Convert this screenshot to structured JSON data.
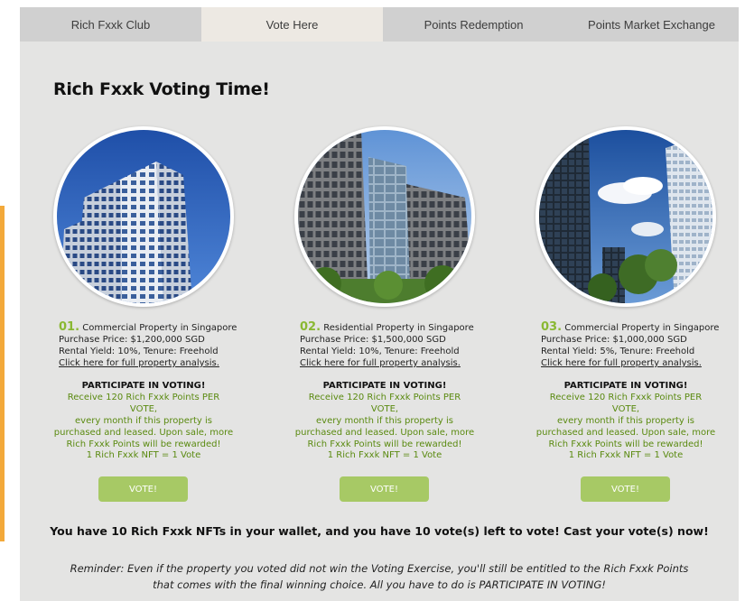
{
  "nav": {
    "tabs": [
      {
        "label": "Rich Fxxk Club",
        "active": false
      },
      {
        "label": "Vote Here",
        "active": true
      },
      {
        "label": "Points Redemption",
        "active": false
      },
      {
        "label": "Points Market Exchange",
        "active": false
      }
    ]
  },
  "page": {
    "title": "Rich Fxxk Voting Time!"
  },
  "properties": [
    {
      "number": "01.",
      "type": "Commercial Property in Singapore",
      "price": "Purchase Price: $1,200,000 SGD",
      "yield": "Rental Yield: 10%, Tenure: Freehold",
      "link": "Click here for full property analysis.",
      "participate_heading": "PARTICIPATE IN VOTING!",
      "participate_lines": [
        "Receive 120 Rich Fxxk Points PER VOTE,",
        "every month if this property is",
        "purchased and leased. Upon sale, more",
        "Rich Fxxk Points will be rewarded!"
      ],
      "nft_rule": "1 Rich Fxxk NFT = 1 Vote",
      "vote_label": "VOTE!",
      "image": "office-tower-photo"
    },
    {
      "number": "02.",
      "type": "Residential Property in Singapore",
      "price": "Purchase Price: $1,500,000 SGD",
      "yield": "Rental Yield: 10%, Tenure: Freehold",
      "link": "Click here for full property analysis.",
      "participate_heading": "PARTICIPATE IN VOTING!",
      "participate_lines": [
        "Receive 120 Rich Fxxk Points PER VOTE,",
        "every month if this property is",
        "purchased and leased. Upon sale, more",
        "Rich Fxxk Points will be rewarded!"
      ],
      "nft_rule": "1 Rich Fxxk NFT = 1 Vote",
      "vote_label": "VOTE!",
      "image": "glass-buildings-photo"
    },
    {
      "number": "03.",
      "type": "Commercial Property in Singapore",
      "price": "Purchase Price: $1,000,000 SGD",
      "yield": "Rental Yield: 5%, Tenure: Freehold",
      "link": "Click here for full property analysis.",
      "participate_heading": "PARTICIPATE IN VOTING!",
      "participate_lines": [
        "Receive 120 Rich Fxxk Points PER VOTE,",
        "every month if this property is",
        "purchased and leased. Upon sale, more",
        "Rich Fxxk Points will be rewarded!"
      ],
      "nft_rule": "1 Rich Fxxk NFT = 1 Vote",
      "vote_label": "VOTE!",
      "image": "skyscrapers-trees-photo"
    }
  ],
  "wallet": {
    "message": "You have 10 Rich Fxxk NFTs in your wallet, and you have 10 vote(s) left to vote! Cast your vote(s) now!"
  },
  "reminder": {
    "line1": "Reminder: Even if the property you voted did not win the Voting Exercise, you'll still be entitled to the Rich Fxxk Points",
    "line2": "that comes with the final winning choice. All you have to do is PARTICIPATE IN VOTING!"
  },
  "colors": {
    "accent_green": "#8ab833",
    "text_green": "#5a8a10",
    "button_green": "#a7c965",
    "side_accent": "#f3a93a",
    "panel_bg": "#e4e4e3",
    "nav_bg": "#d0d0d0",
    "nav_active_bg": "#ede9e3"
  }
}
